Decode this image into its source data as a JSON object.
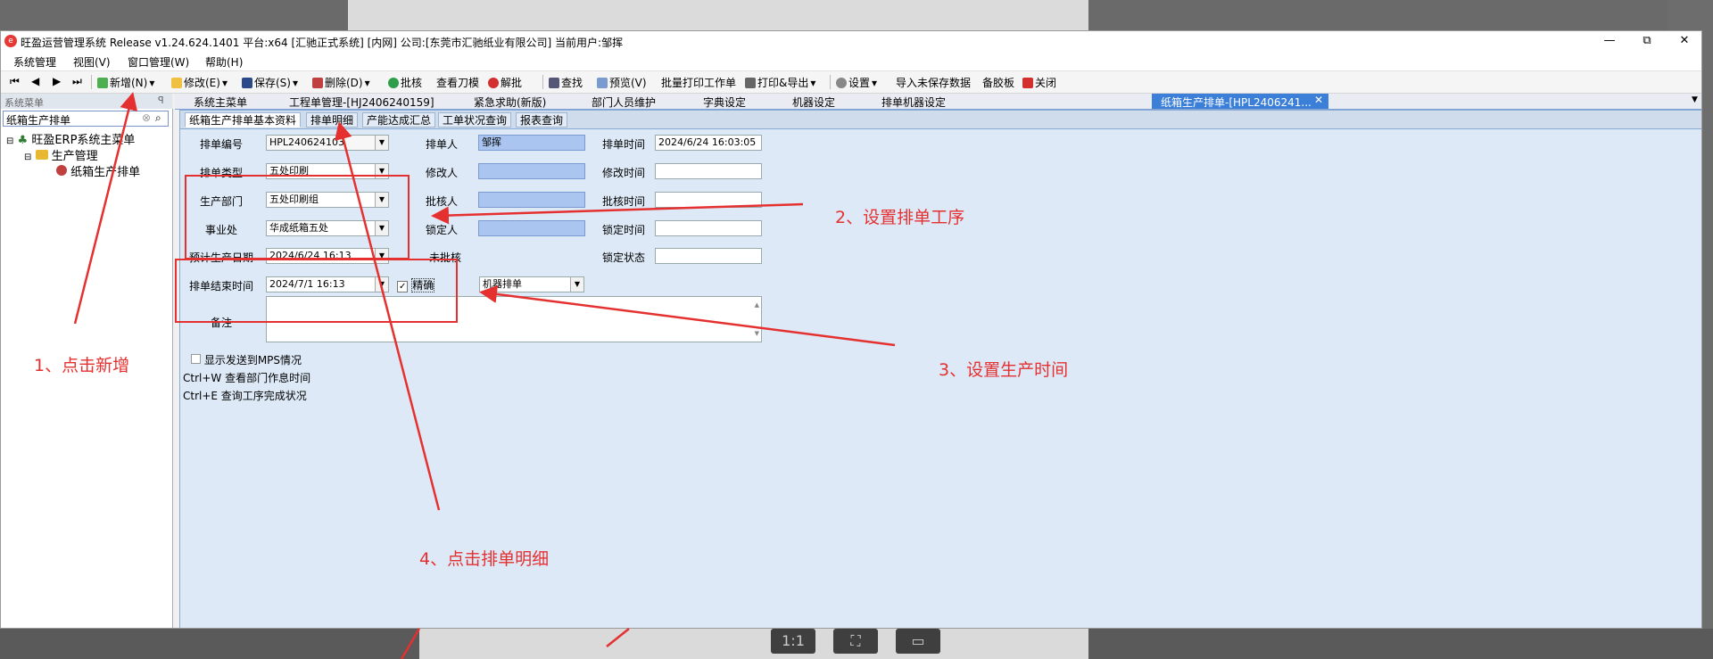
{
  "window": {
    "title": "旺盈运营管理系统 Release v1.24.624.1401 平台:x64  [汇驰正式系统] [内网] 公司:[东莞市汇驰纸业有限公司] 当前用户:邹挥"
  },
  "menu": [
    "系统管理",
    "视图(V)",
    "窗口管理(W)",
    "帮助(H)"
  ],
  "toolbar": {
    "add": "新增(N)",
    "edit": "修改(E)",
    "save": "保存(S)",
    "delete": "删除(D)",
    "approve": "批核",
    "view_blade": "查看刀模",
    "unapprove": "解批",
    "find": "查找",
    "preview": "预览(V)",
    "batch_print": "批量打印工作单",
    "print_export": "打印&导出",
    "settings": "设置",
    "import_unsaved": "导入未保存数据",
    "rubber_plate": "备胶板",
    "close": "关闭"
  },
  "left_panel": {
    "header": "系统菜单",
    "pin": "ꟼ",
    "search_value": "纸箱生产排单",
    "tree": {
      "root": "旺盈ERP系统主菜单",
      "child": "生产管理",
      "leaf": "纸箱生产排单"
    }
  },
  "doc_tabs": [
    "系统主菜单",
    "工程单管理-[HJ2406240159]",
    "紧急求助(新版)",
    "部门人员维护",
    "字典设定",
    "机器设定",
    "排单机器设定",
    "纸箱生产排单-[HPL2406241..."
  ],
  "sub_tabs": [
    "纸箱生产排单基本资料",
    "排单明细",
    "产能达成汇总",
    "工单状况查询",
    "报表查询"
  ],
  "form": {
    "schedule_no_label": "排单编号",
    "schedule_no": "HPL240624103",
    "schedule_type_label": "排单类型",
    "schedule_type": "五处印刷",
    "dept_label": "生产部门",
    "dept": "五处印刷组",
    "division_label": "事业处",
    "division": "华成纸箱五处",
    "planned_date_label": "预计生产日期",
    "planned_date": "2024/6/24 16:13",
    "end_time_label": "排单结束时间",
    "end_time": "2024/7/1 16:13",
    "precise_label": "精确",
    "scheduler_label": "排单人",
    "scheduler": "邹挥",
    "modifier_label": "修改人",
    "approver_label": "批核人",
    "locker_label": "锁定人",
    "unapproved": "未批核",
    "machine_schedule": "机器排单",
    "schedule_time_label": "排单时间",
    "schedule_time": "2024/6/24 16:03:05",
    "modify_time_label": "修改时间",
    "approve_time_label": "批核时间",
    "lock_time_label": "锁定时间",
    "lock_status_label": "锁定状态",
    "remarks_label": "备注",
    "show_mps": "显示发送到MPS情况",
    "hint1": "Ctrl+W 查看部门作息时间",
    "hint2": "Ctrl+E  查询工序完成状况"
  },
  "annotations": {
    "step1": "1、点击新增",
    "step2": "2、设置排单工序",
    "step3": "3、设置生产时间",
    "step4": "4、点击排单明细"
  },
  "viewer": {
    "ratio": "1:1"
  },
  "colors": {
    "annotation": "#e53030",
    "active_tab": "#3b7fd9",
    "form_bg": "#dde9f7"
  }
}
